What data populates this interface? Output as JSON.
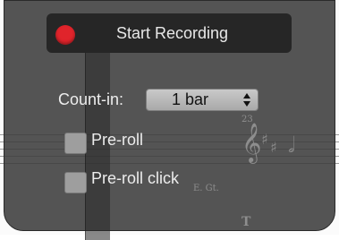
{
  "record": {
    "label": "Start Recording"
  },
  "count_in": {
    "label": "Count-in:",
    "value": "1 bar"
  },
  "options": [
    {
      "label": "Pre-roll",
      "checked": false
    },
    {
      "label": "Pre-roll click",
      "checked": false
    }
  ],
  "score": {
    "measure_number": "23",
    "instrument": "E. Gt."
  },
  "colors": {
    "record_dot": "#e0242b",
    "popover": "#3c3c3c"
  }
}
